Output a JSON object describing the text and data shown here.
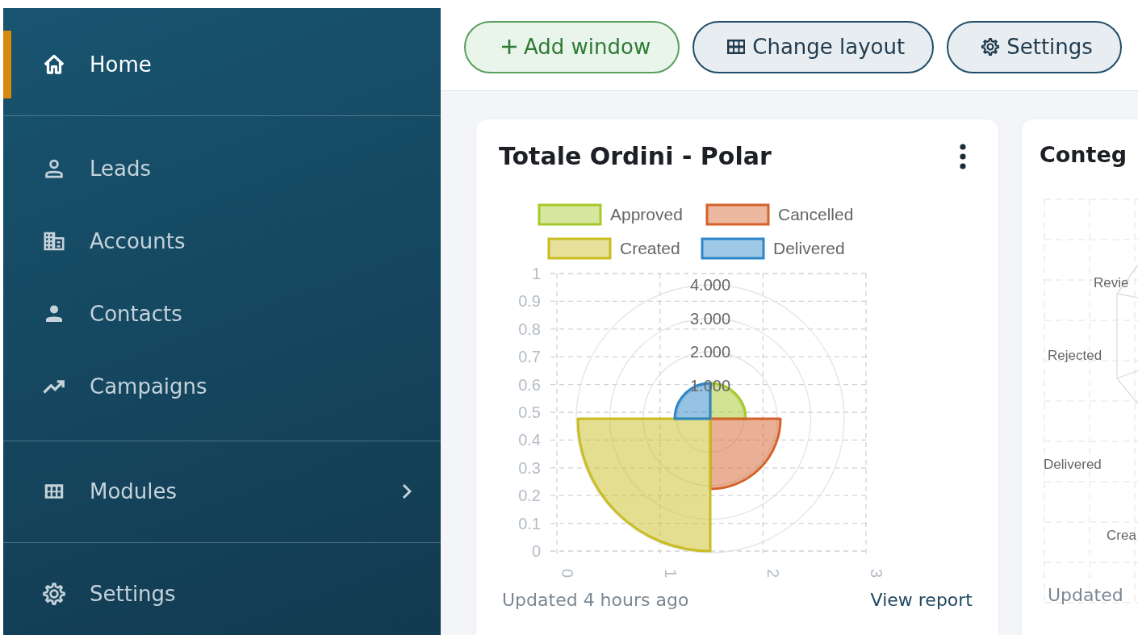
{
  "sidebar": {
    "groups": [
      {
        "items": [
          {
            "label": "Home",
            "selected": true,
            "has_submenu": false
          }
        ]
      },
      {
        "items": [
          {
            "label": "Leads",
            "selected": false,
            "has_submenu": false
          },
          {
            "label": "Accounts",
            "selected": false,
            "has_submenu": false
          },
          {
            "label": "Contacts",
            "selected": false,
            "has_submenu": false
          },
          {
            "label": "Campaigns",
            "selected": false,
            "has_submenu": false
          }
        ]
      },
      {
        "items": [
          {
            "label": "Modules",
            "selected": false,
            "has_submenu": true
          }
        ]
      },
      {
        "items": [
          {
            "label": "Settings",
            "selected": false,
            "has_submenu": false
          }
        ]
      }
    ]
  },
  "toolbar": {
    "buttons": [
      {
        "label": "Add window",
        "kind": "primary"
      },
      {
        "label": "Change layout",
        "kind": "secondary"
      },
      {
        "label": "Settings",
        "kind": "secondary"
      }
    ]
  },
  "cards": [
    {
      "kind": "polar",
      "title": "Totale Ordini - Polar",
      "legend": [
        {
          "label": "Approved",
          "color": "#a6c92a"
        },
        {
          "label": "Cancelled",
          "color": "#d4622b"
        },
        {
          "label": "Created",
          "color": "#c9bd22"
        },
        {
          "label": "Delivered",
          "color": "#2d86c9"
        }
      ],
      "ring_labels": [
        "4.000",
        "3.000",
        "2.000",
        "1.000"
      ],
      "y_axis_labels": [
        "1",
        "0.9",
        "0.8",
        "0.7",
        "0.6",
        "0.5",
        "0.4",
        "0.3",
        "0.2",
        "0.1",
        "0"
      ],
      "x_axis_labels": [
        "0",
        "1",
        "2",
        "3"
      ],
      "updated": "Updated 4 hours ago",
      "link": "View report"
    },
    {
      "kind": "radar",
      "title": "Conteg",
      "axis_labels": [
        "Revie",
        "Rejected",
        "Delivered",
        "Crea"
      ],
      "updated": "Updated"
    }
  ]
}
